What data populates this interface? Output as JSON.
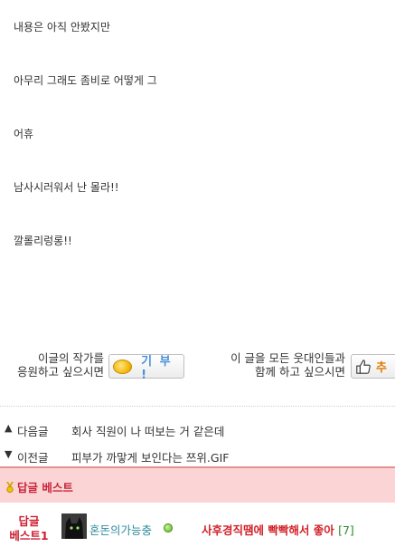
{
  "post": {
    "lines": [
      "내용은 아직 안봤지만",
      "아무리 그래도 좀비로 어떻게 그",
      "어휴",
      "남사시러워서 난 몰라!!",
      "깔롤리렁롱!!"
    ]
  },
  "support": {
    "author_line1": "이글의 작가를",
    "author_line2": "응원하고 싶으시면",
    "donate_label": "기 부 !",
    "share_line1": "이 글을 모든 웃대인들과",
    "share_line2": "함께 하고 싶으시면",
    "recommend_label": "추"
  },
  "nav": {
    "next_arrow": "▲",
    "next_label": "다음글",
    "next_title": "회사 직원이 나 떠보는 거 같은데",
    "prev_arrow": "▼",
    "prev_label": "이전글",
    "prev_title": "피부가 까맣게 보인다는 쯔위.GIF"
  },
  "best": {
    "header": "답글 베스트",
    "rank_line1": "답글",
    "rank_line2": "베스트1",
    "author": "혼돈의가능충",
    "comment": "사후경직땜에 빡빡해서 좋아",
    "count": "[7]"
  },
  "colors": {
    "best_bg": "#fbd5d5",
    "best_text": "#c8253a",
    "author_link": "#2d8a9e",
    "donate_text": "#4a90d9"
  }
}
